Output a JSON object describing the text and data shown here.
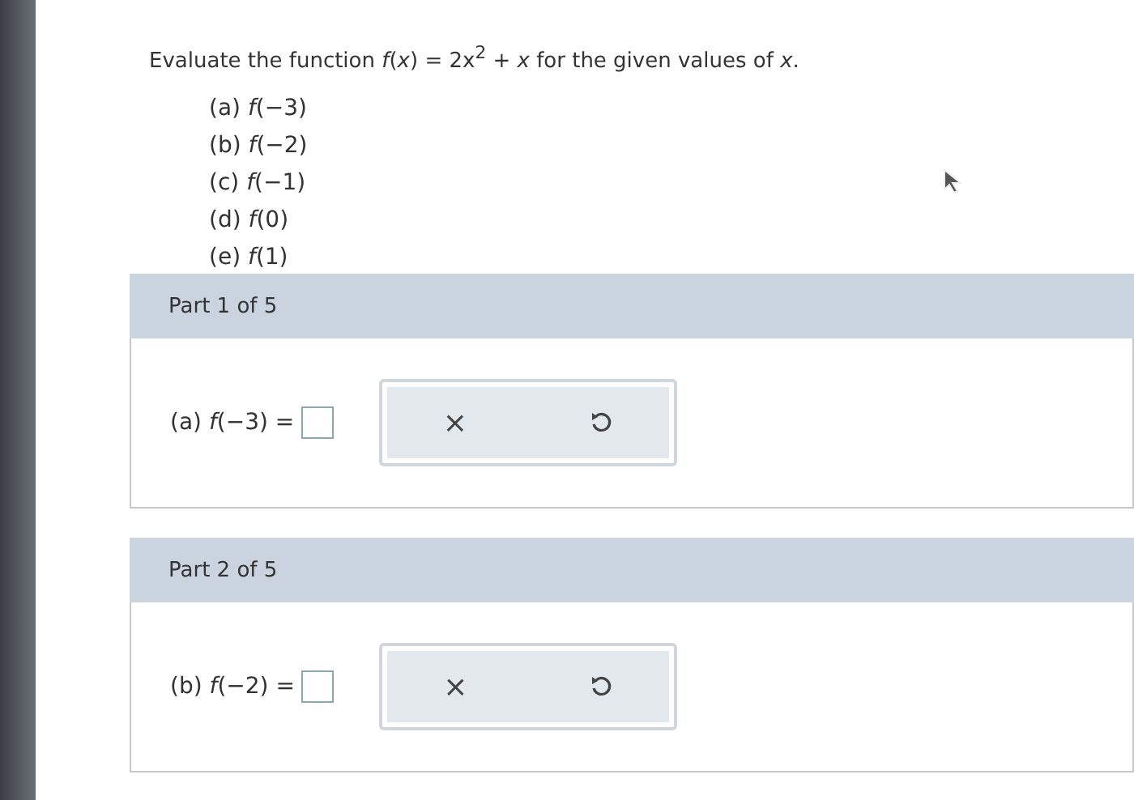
{
  "question": {
    "instruction": "Evaluate the function *f*(*x*) = 2x$^{2}$ + *x* for the given values of *x*.",
    "items": [
      "(a) *f*(−3)",
      "(b) *f*(−2)",
      "(c) *f*(−1)",
      "(d) *f*(0)",
      "(e) *f*(1)"
    ]
  },
  "parts": [
    {
      "header": "Part 1 of 5",
      "prompt": "(a) *f*(−3) =",
      "clear_label": "×"
    },
    {
      "header": "Part 2 of 5",
      "prompt": "(b) *f*(−2) =",
      "clear_label": "×"
    }
  ]
}
